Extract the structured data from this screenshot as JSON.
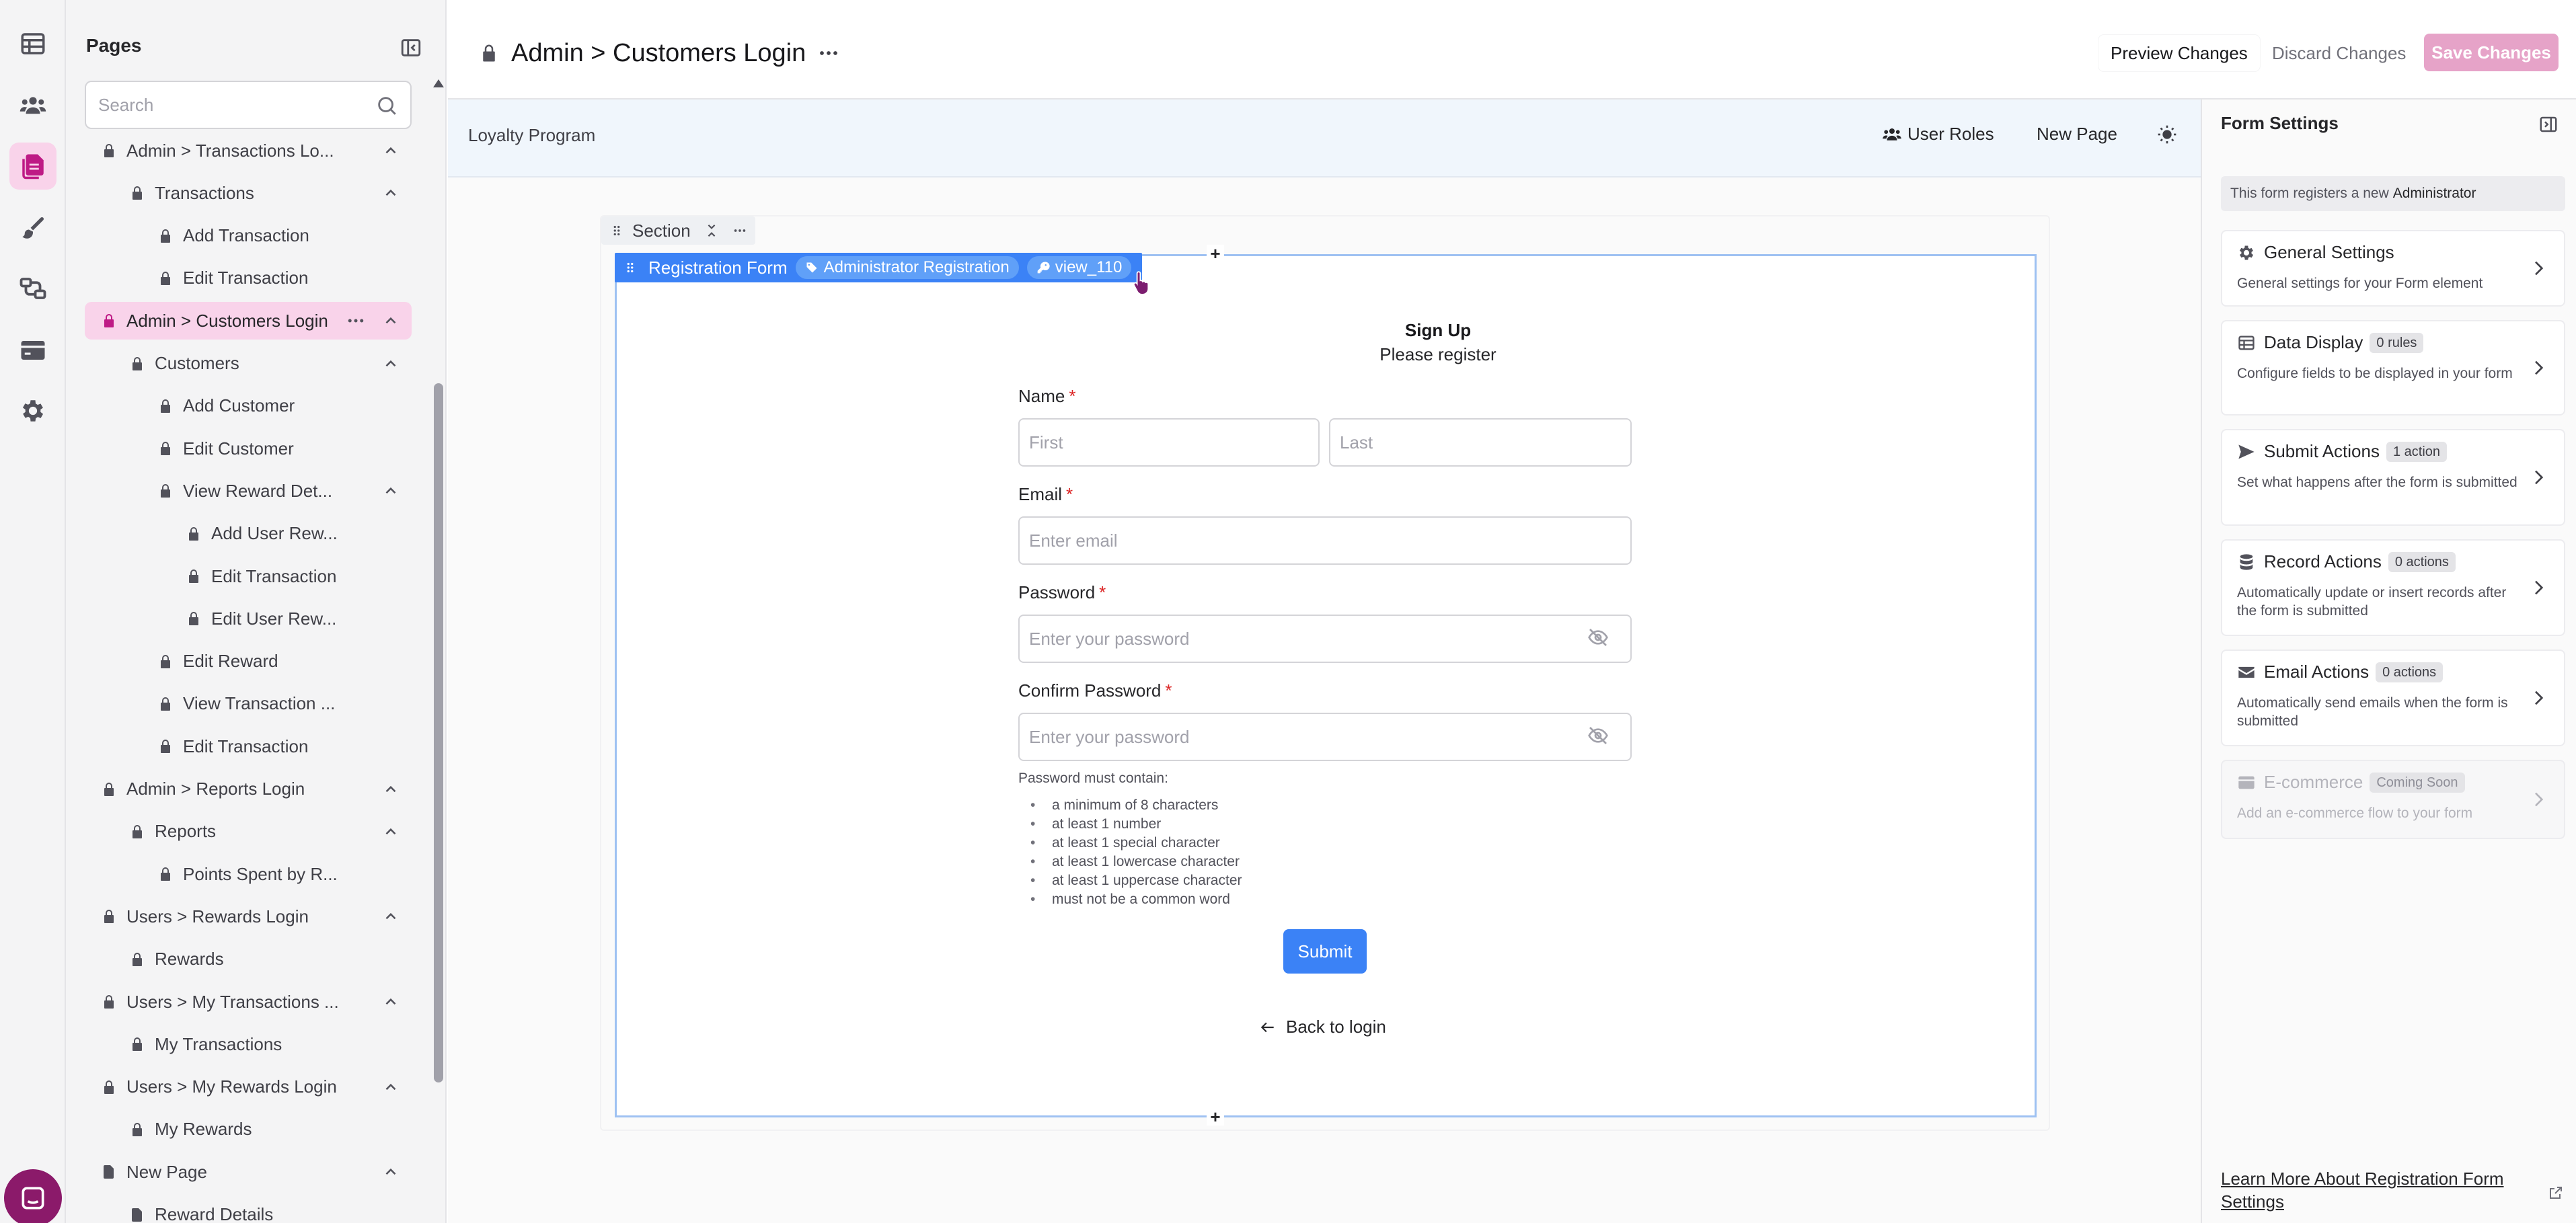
{
  "rail": {
    "items": [
      {
        "name": "tables"
      },
      {
        "name": "users"
      },
      {
        "name": "pages"
      },
      {
        "name": "design"
      },
      {
        "name": "flows"
      },
      {
        "name": "payments"
      },
      {
        "name": "settings"
      }
    ],
    "active": "pages"
  },
  "pages_panel": {
    "title": "Pages",
    "search_placeholder": "Search",
    "items": [
      {
        "label": "Admin > Transactions Lo...",
        "depth": 0,
        "icon": "lock-icon",
        "chevron": true
      },
      {
        "label": "Transactions",
        "depth": 1,
        "icon": "lock-icon",
        "chevron": true
      },
      {
        "label": "Add Transaction",
        "depth": 2,
        "icon": "lock-icon"
      },
      {
        "label": "Edit Transaction",
        "depth": 2,
        "icon": "lock-icon"
      },
      {
        "label": "Admin > Customers Login",
        "depth": 0,
        "icon": "lock-icon",
        "chevron": true,
        "selected": true
      },
      {
        "label": "Customers",
        "depth": 1,
        "icon": "lock-icon",
        "chevron": true
      },
      {
        "label": "Add Customer",
        "depth": 2,
        "icon": "lock-icon"
      },
      {
        "label": "Edit Customer",
        "depth": 2,
        "icon": "lock-icon"
      },
      {
        "label": "View Reward Det...",
        "depth": 2,
        "icon": "lock-icon",
        "chevron": true
      },
      {
        "label": "Add User Rew...",
        "depth": 3,
        "icon": "lock-icon"
      },
      {
        "label": "Edit Transaction",
        "depth": 3,
        "icon": "lock-icon"
      },
      {
        "label": "Edit User Rew...",
        "depth": 3,
        "icon": "lock-icon"
      },
      {
        "label": "Edit Reward",
        "depth": 2,
        "icon": "lock-icon"
      },
      {
        "label": "View Transaction ...",
        "depth": 2,
        "icon": "lock-icon"
      },
      {
        "label": "Edit Transaction",
        "depth": 2,
        "icon": "lock-icon"
      },
      {
        "label": "Admin > Reports Login",
        "depth": 0,
        "icon": "lock-icon",
        "chevron": true
      },
      {
        "label": "Reports",
        "depth": 1,
        "icon": "lock-icon",
        "chevron": true
      },
      {
        "label": "Points Spent by R...",
        "depth": 2,
        "icon": "lock-icon"
      },
      {
        "label": "Users > Rewards Login",
        "depth": 0,
        "icon": "lock-icon",
        "chevron": true
      },
      {
        "label": "Rewards",
        "depth": 1,
        "icon": "lock-icon"
      },
      {
        "label": "Users > My Transactions ...",
        "depth": 0,
        "icon": "lock-icon",
        "chevron": true
      },
      {
        "label": "My Transactions",
        "depth": 1,
        "icon": "lock-icon"
      },
      {
        "label": "Users > My Rewards Login",
        "depth": 0,
        "icon": "lock-icon",
        "chevron": true
      },
      {
        "label": "My Rewards",
        "depth": 1,
        "icon": "lock-icon"
      },
      {
        "label": "New Page",
        "depth": 0,
        "icon": "page-icon",
        "chevron": true
      },
      {
        "label": "Reward Details",
        "depth": 1,
        "icon": "page-icon"
      }
    ]
  },
  "header": {
    "title": "Admin > Customers Login",
    "preview_label": "Preview Changes",
    "discard_label": "Discard Changes",
    "save_label": "Save Changes"
  },
  "app_bar": {
    "app_name": "Loyalty Program",
    "user_roles_label": "User Roles",
    "new_page_label": "New Page"
  },
  "canvas": {
    "section_label": "Section",
    "form_label": "Registration Form",
    "form_pill_role": "Administrator Registration",
    "form_pill_view": "view_110"
  },
  "form": {
    "title": "Sign Up",
    "subtitle": "Please register",
    "name_label": "Name",
    "first_placeholder": "First",
    "last_placeholder": "Last",
    "email_label": "Email",
    "email_placeholder": "Enter email",
    "password_label": "Password",
    "password_placeholder": "Enter your password",
    "confirm_label": "Confirm Password",
    "confirm_placeholder": "Enter your password",
    "required_mark": "*",
    "rules_title": "Password must contain:",
    "rules": [
      "a minimum of 8 characters",
      "at least 1 number",
      "at least 1 special character",
      "at least 1 lowercase character",
      "at least 1 uppercase character",
      "must not be a common word"
    ],
    "submit_label": "Submit",
    "back_label": "Back to login"
  },
  "settings": {
    "title": "Form Settings",
    "note_prefix": "This form registers a new",
    "note_role": "Administrator",
    "cards": [
      {
        "title": "General Settings",
        "badge": "",
        "desc": "General settings for your Form element",
        "icon": "gear-icon"
      },
      {
        "title": "Data Display",
        "badge": "0 rules",
        "desc": "Configure fields to be displayed in your form",
        "icon": "table-icon"
      },
      {
        "title": "Submit Actions",
        "badge": "1 action",
        "desc": "Set what happens after the form is submitted",
        "icon": "send-icon"
      },
      {
        "title": "Record Actions",
        "badge": "0 actions",
        "desc": "Automatically update or insert records after the form is submitted",
        "icon": "database-icon"
      },
      {
        "title": "Email Actions",
        "badge": "0 actions",
        "desc": "Automatically send emails when the form is submitted",
        "icon": "envelope-icon"
      },
      {
        "title": "E-commerce",
        "badge": "Coming Soon",
        "desc": "Add an e-commerce flow to your form",
        "icon": "credit-card-icon",
        "disabled": true
      }
    ],
    "learn_more": "Learn More About Registration Form Settings"
  },
  "colors": {
    "accent_pink": "#be1a85",
    "selected_bg": "#f9d3ea",
    "form_blue": "#3b82f6",
    "save_button": "#e6a3c8"
  }
}
